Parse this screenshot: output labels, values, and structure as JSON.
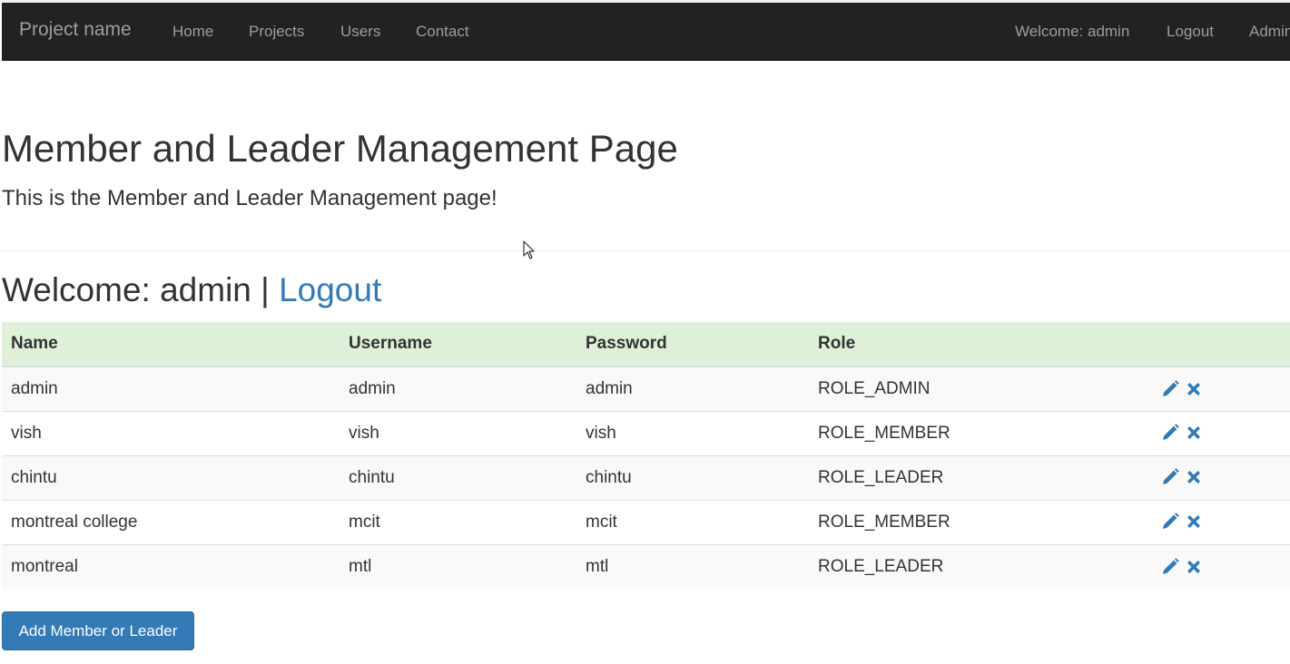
{
  "navbar": {
    "brand": "Project name",
    "links": [
      "Home",
      "Projects",
      "Users",
      "Contact"
    ],
    "welcome": "Welcome: admin",
    "logout": "Logout",
    "admin": "Admin"
  },
  "header": {
    "title": "Member and Leader Management Page",
    "lead": "This is the Member and Leader Management page!"
  },
  "welcome_line": {
    "text": "Welcome: admin",
    "separator": "|",
    "logout": "Logout"
  },
  "table": {
    "columns": [
      "Name",
      "Username",
      "Password",
      "Role"
    ],
    "rows": [
      [
        "admin",
        "admin",
        "admin",
        "ROLE_ADMIN"
      ],
      [
        "vish",
        "vish",
        "vish",
        "ROLE_MEMBER"
      ],
      [
        "chintu",
        "chintu",
        "chintu",
        "ROLE_LEADER"
      ],
      [
        "montreal college",
        "mcit",
        "mcit",
        "ROLE_MEMBER"
      ],
      [
        "montreal",
        "mtl",
        "mtl",
        "ROLE_LEADER"
      ]
    ],
    "actions": [
      "pencil-icon",
      "remove-icon"
    ]
  },
  "add_button": "Add Member or Leader",
  "colors": {
    "navbar_bg": "#222222",
    "nav_text": "#9d9d9d",
    "link_blue": "#337ab7",
    "table_header_bg": "#dff0d8",
    "primary_button": "#337ab7"
  }
}
